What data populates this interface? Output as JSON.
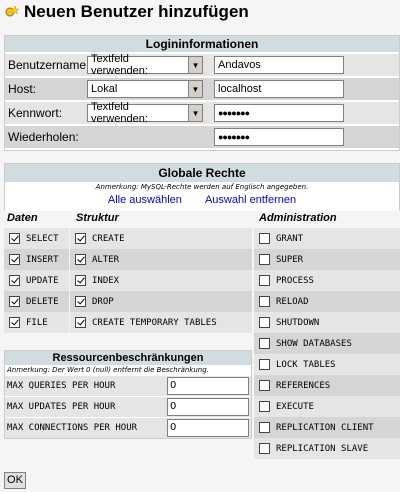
{
  "page_title": "Neuen Benutzer hinzufügen",
  "login": {
    "header": "Logininformationen",
    "rows": [
      {
        "label": "Benutzername:",
        "select": "Textfeld verwenden:",
        "value": "Andavos"
      },
      {
        "label": "Host:",
        "select": "Lokal",
        "value": "localhost"
      },
      {
        "label": "Kennwort:",
        "select": "Textfeld verwenden:",
        "value": "●●●●●●●"
      },
      {
        "label": "Wiederholen:",
        "select": "",
        "value": "●●●●●●●"
      }
    ]
  },
  "global": {
    "header": "Globale Rechte",
    "note": "Anmerkung: MySQL-Rechte werden auf Englisch angegeben.",
    "select_all": "Alle auswählen",
    "deselect_all": "Auswahl entfernen",
    "col_data": "Daten",
    "col_struct": "Struktur",
    "col_admin": "Administration",
    "data_privs": [
      {
        "name": "SELECT",
        "checked": true
      },
      {
        "name": "INSERT",
        "checked": true
      },
      {
        "name": "UPDATE",
        "checked": true
      },
      {
        "name": "DELETE",
        "checked": true
      },
      {
        "name": "FILE",
        "checked": true
      }
    ],
    "struct_privs": [
      {
        "name": "CREATE",
        "checked": true
      },
      {
        "name": "ALTER",
        "checked": true
      },
      {
        "name": "INDEX",
        "checked": true
      },
      {
        "name": "DROP",
        "checked": true
      },
      {
        "name": "CREATE TEMPORARY TABLES",
        "checked": true
      }
    ],
    "admin_privs": [
      {
        "name": "GRANT",
        "checked": false
      },
      {
        "name": "SUPER",
        "checked": false
      },
      {
        "name": "PROCESS",
        "checked": false
      },
      {
        "name": "RELOAD",
        "checked": false
      },
      {
        "name": "SHUTDOWN",
        "checked": false
      },
      {
        "name": "SHOW DATABASES",
        "checked": false
      },
      {
        "name": "LOCK TABLES",
        "checked": false
      },
      {
        "name": "REFERENCES",
        "checked": false
      },
      {
        "name": "EXECUTE",
        "checked": false
      },
      {
        "name": "REPLICATION CLIENT",
        "checked": false
      },
      {
        "name": "REPLICATION SLAVE",
        "checked": false
      }
    ]
  },
  "resources": {
    "header": "Ressourcenbeschränkungen",
    "note": "Anmerkung: Der Wert 0 (null) entfernt die Beschränkung.",
    "rows": [
      {
        "label": "MAX QUERIES PER HOUR",
        "value": "0"
      },
      {
        "label": "MAX UPDATES PER HOUR",
        "value": "0"
      },
      {
        "label": "MAX CONNECTIONS PER HOUR",
        "value": "0"
      }
    ]
  },
  "ok_label": "OK"
}
